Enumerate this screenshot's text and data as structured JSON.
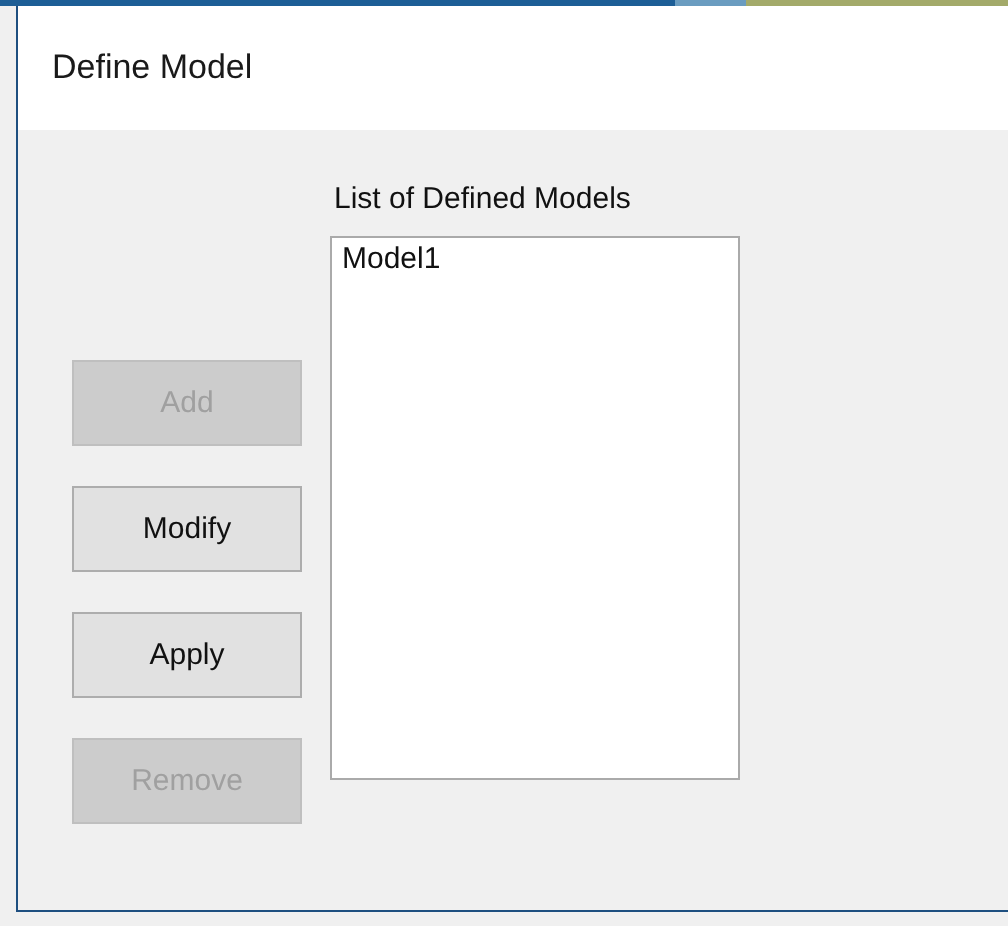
{
  "window": {
    "title": "Define Model"
  },
  "list_label": "List of Defined Models",
  "buttons": [
    {
      "label": "Add",
      "disabled": true
    },
    {
      "label": "Modify",
      "disabled": false
    },
    {
      "label": "Apply",
      "disabled": false
    },
    {
      "label": "Remove",
      "disabled": true
    }
  ],
  "models": [
    {
      "label": "Model1",
      "selected": false
    }
  ]
}
